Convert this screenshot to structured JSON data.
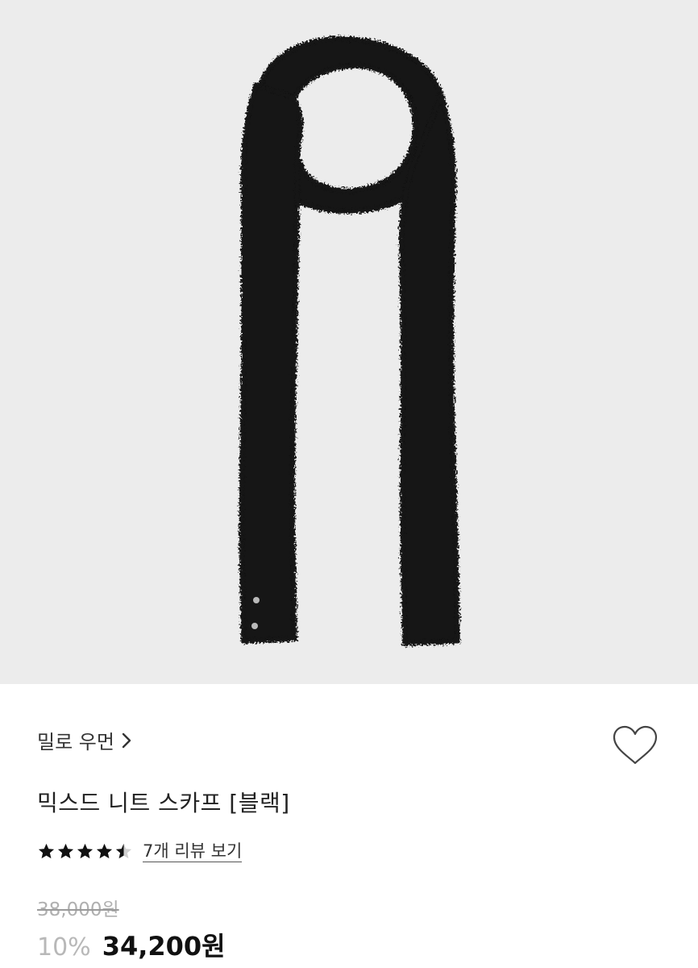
{
  "product": {
    "brand_label": "밀로 우먼",
    "title": "믹스드 니트 스카프 [블랙]",
    "image_alt": "black mixed knit scarf product image"
  },
  "rating": {
    "stars_filled": 4.5,
    "stars_total": 5,
    "review_link": "7개 리뷰 보기"
  },
  "pricing": {
    "original_price": "38,000원",
    "discount_rate": "10%",
    "sale_price": "34,200원"
  },
  "icons": {
    "brand_chevron": "chevron-right-icon",
    "wishlist": "heart-outline-icon",
    "star": "star-icon"
  },
  "colors": {
    "hero_bg": "#ececec",
    "scarf": "#121212",
    "star": "#111111",
    "muted": "#b0b0b0"
  }
}
